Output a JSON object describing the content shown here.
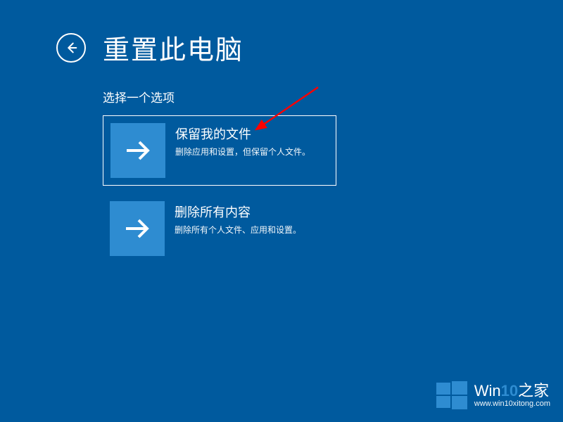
{
  "header": {
    "title": "重置此电脑"
  },
  "subtitle": "选择一个选项",
  "options": [
    {
      "title": "保留我的文件",
      "desc": "删除应用和设置，但保留个人文件。",
      "selected": true
    },
    {
      "title": "删除所有内容",
      "desc": "删除所有个人文件、应用和设置。",
      "selected": false
    }
  ],
  "watermark": {
    "brand_prefix": "Win",
    "brand_accent": "10",
    "brand_suffix": "之家",
    "url": "www.win10xitong.com"
  },
  "colors": {
    "background": "#005a9e",
    "tile": "#2e8cd1",
    "arrow_annotation": "#ff0000"
  }
}
